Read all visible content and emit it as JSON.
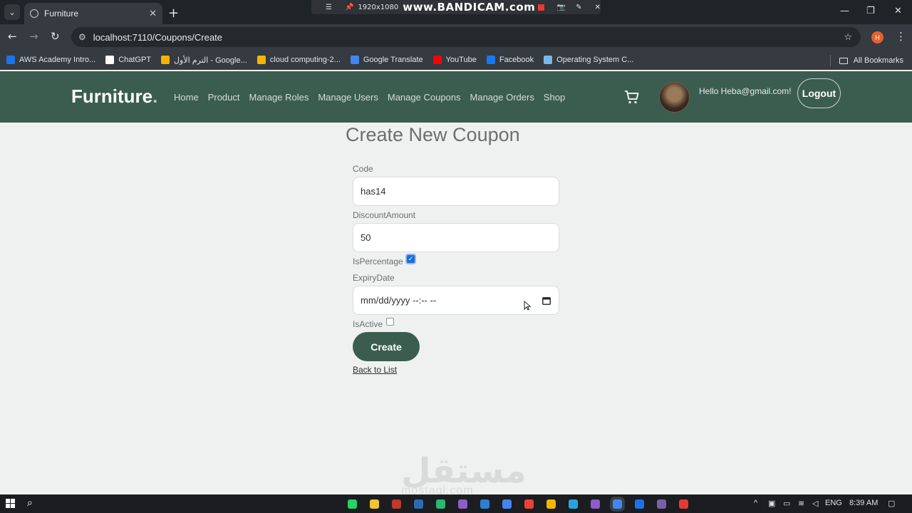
{
  "browser": {
    "tab_title": "Furniture",
    "url": "localhost:7110/Coupons/Create",
    "recording_overlay": {
      "resolution": "1920x1080",
      "brand": "www.BANDICAM.com"
    },
    "profile_initial": "H",
    "bookmarks": [
      {
        "label": "AWS Academy Intro...",
        "color": "#1a73e8"
      },
      {
        "label": "ChatGPT",
        "color": "#ffffff"
      },
      {
        "label": "الترم الأول - Google...",
        "color": "#f4b400"
      },
      {
        "label": "cloud computing-2...",
        "color": "#f4b400"
      },
      {
        "label": "Google Translate",
        "color": "#4285f4"
      },
      {
        "label": "YouTube",
        "color": "#ff0000"
      },
      {
        "label": "Facebook",
        "color": "#1877f2"
      },
      {
        "label": "Operating System C...",
        "color": "#7cb7e8"
      }
    ],
    "all_bookmarks_label": "All Bookmarks"
  },
  "site": {
    "logo_text": "Furniture",
    "logo_dot": ".",
    "nav": [
      "Home",
      "Product",
      "Manage Roles",
      "Manage Users",
      "Manage Coupons",
      "Manage Orders",
      "Shop"
    ],
    "greeting": "Hello Heba@gmail.com!",
    "logout_label": "Logout",
    "brand_color": "#3b5d50"
  },
  "form": {
    "title": "Create New Coupon",
    "code_label": "Code",
    "code_value": "has14",
    "discount_label": "DiscountAmount",
    "discount_value": "50",
    "is_percentage_label": "IsPercentage",
    "is_percentage_checked": true,
    "expiry_label": "ExpiryDate",
    "expiry_value": "mm/dd/yyyy --:-- --",
    "is_active_label": "IsActive",
    "is_active_checked": false,
    "create_label": "Create",
    "back_label": "Back to List"
  },
  "watermark": {
    "arabic": "مستقل",
    "latin": "mostaql.com"
  },
  "taskbar": {
    "language": "ENG",
    "time": "8:39 AM"
  }
}
